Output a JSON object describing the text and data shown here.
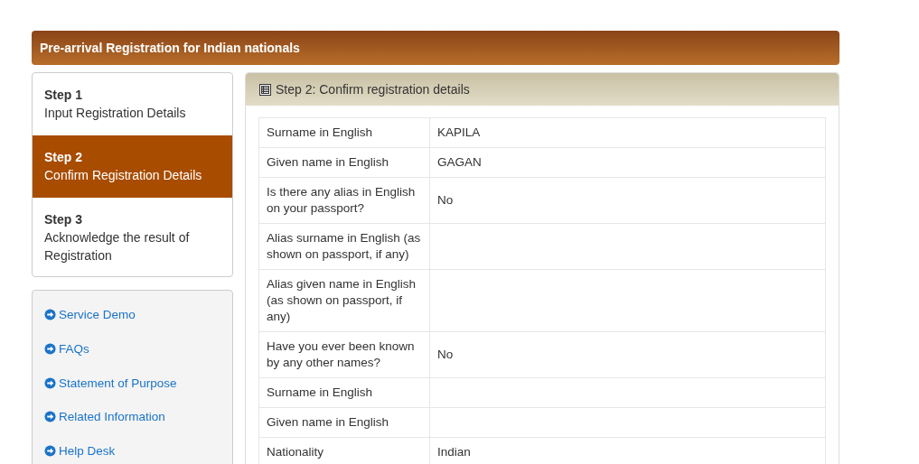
{
  "header": {
    "title": "Pre-arrival Registration for Indian nationals"
  },
  "steps": [
    {
      "step": "Step 1",
      "label": "Input Registration Details",
      "selected": false
    },
    {
      "step": "Step 2",
      "label": "Confirm Registration Details",
      "selected": true
    },
    {
      "step": "Step 3",
      "label": "Acknowledge the result of Registration",
      "selected": false
    }
  ],
  "links": [
    "Service Demo",
    "FAQs",
    "Statement of Purpose",
    "Related Information",
    "Help Desk"
  ],
  "panel": {
    "title": "Step 2: Confirm registration details",
    "rows": [
      {
        "label": "Surname in English",
        "value": "KAPILA"
      },
      {
        "label": "Given name in English",
        "value": "GAGAN"
      },
      {
        "label": "Is there any alias in English on your passport?",
        "value": "No"
      },
      {
        "label": "Alias surname in English (as shown on passport, if any)"
      },
      {
        "label": "Alias given name in English (as shown on passport, if any)"
      },
      {
        "label": "Have you ever been known by any other names?",
        "value": "No"
      },
      {
        "label": "Surname in English"
      },
      {
        "label": "Given name in English"
      },
      {
        "label": "Nationality",
        "value": "Indian"
      }
    ]
  }
}
